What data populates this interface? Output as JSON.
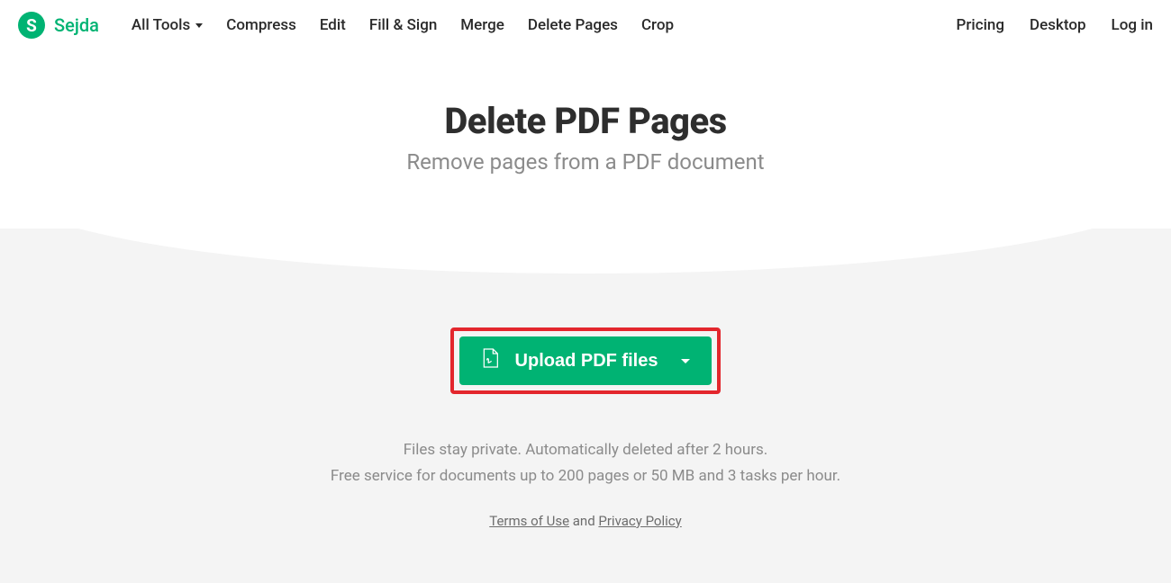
{
  "brand": {
    "letter": "S",
    "name": "Sejda"
  },
  "nav": {
    "allTools": "All Tools",
    "compress": "Compress",
    "edit": "Edit",
    "fillSign": "Fill & Sign",
    "merge": "Merge",
    "deletePages": "Delete Pages",
    "crop": "Crop",
    "pricing": "Pricing",
    "desktop": "Desktop",
    "login": "Log in"
  },
  "hero": {
    "title": "Delete PDF Pages",
    "subtitle": "Remove pages from a PDF document"
  },
  "upload": {
    "label": "Upload PDF files"
  },
  "info": {
    "line1": "Files stay private. Automatically deleted after 2 hours.",
    "line2": "Free service for documents up to 200 pages or 50 MB and 3 tasks per hour."
  },
  "legal": {
    "terms": "Terms of Use",
    "and": " and ",
    "privacy": "Privacy Policy"
  }
}
